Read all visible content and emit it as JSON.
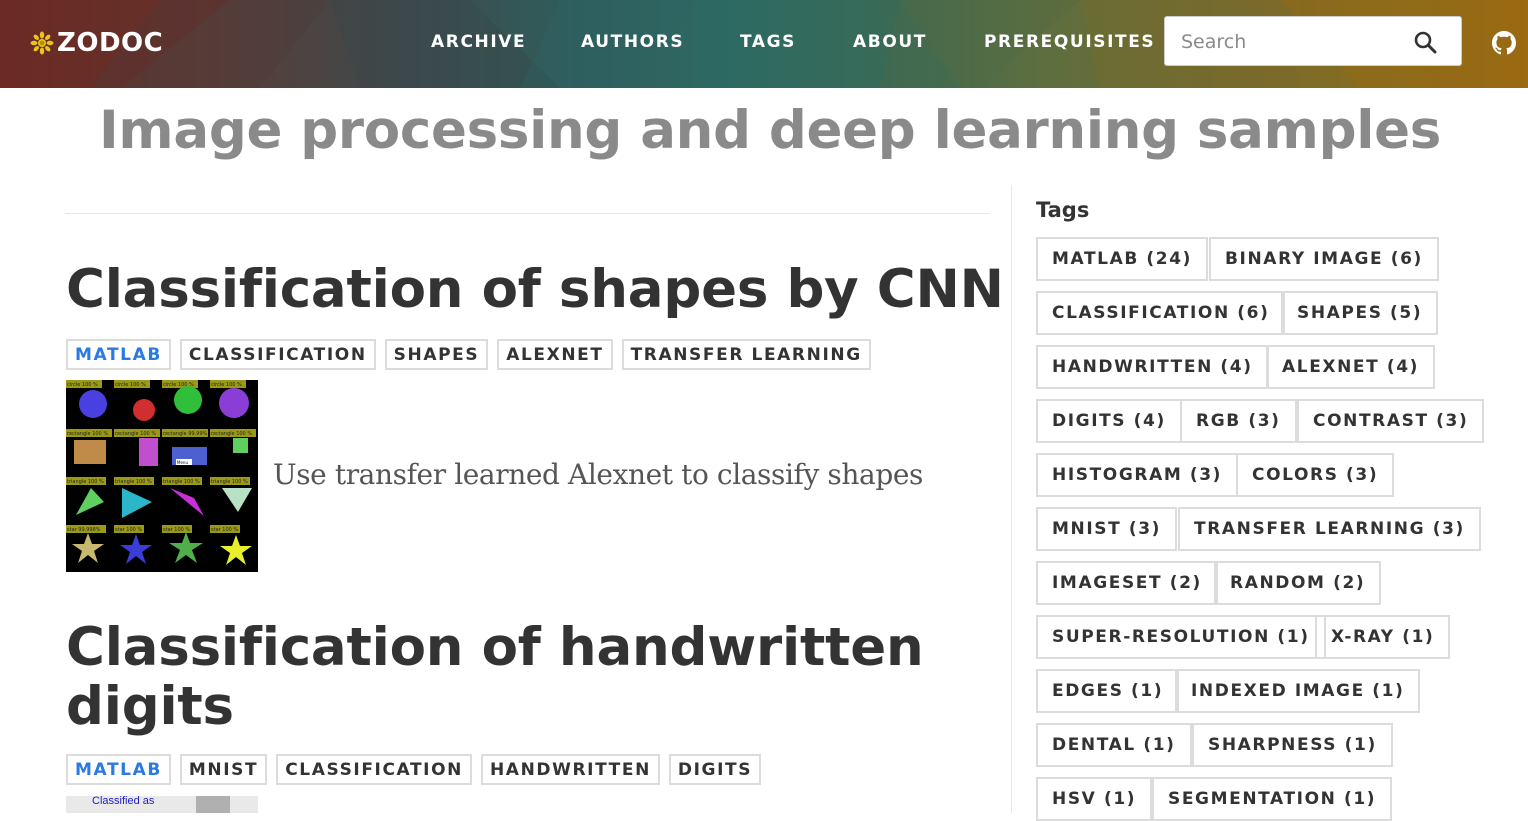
{
  "header": {
    "logo_text": "ZODOC",
    "nav": [
      "ARCHIVE",
      "AUTHORS",
      "TAGS",
      "ABOUT",
      "PREREQUISITES"
    ],
    "search_placeholder": "Search"
  },
  "page": {
    "title": "Image processing and deep learning samples"
  },
  "posts": [
    {
      "title": "Classification of shapes by CNN",
      "tags": [
        "MATLAB",
        "CLASSIFICATION",
        "SHAPES",
        "ALEXNET",
        "TRANSFER LEARNING"
      ],
      "excerpt": "Use transfer learned Alexnet to classify shapes",
      "thumb_labels": [
        "circle 100 %",
        "rectangle 100 %",
        "rectangle 99.99%",
        "triangle 100 %",
        "star 99.998%",
        "star 100 %"
      ],
      "thumb_overlay": "Menu"
    },
    {
      "title_line1": "Classification of handwritten",
      "title_line2": "digits",
      "tags": [
        "MATLAB",
        "MNIST",
        "CLASSIFICATION",
        "HANDWRITTEN",
        "DIGITS"
      ],
      "thumb_caption": "Classified as"
    }
  ],
  "sidebar": {
    "title": "Tags",
    "tags": [
      "MATLAB (24)",
      "BINARY IMAGE (6)",
      "CLASSIFICATION (6)",
      "SHAPES (5)",
      "HANDWRITTEN (4)",
      "ALEXNET (4)",
      "DIGITS (4)",
      "RGB (3)",
      "CONTRAST (3)",
      "HISTOGRAM (3)",
      "COLORS (3)",
      "MNIST (3)",
      "TRANSFER LEARNING (3)",
      "IMAGESET (2)",
      "RANDOM (2)",
      "SUPER-RESOLUTION (1)",
      "X-RAY (1)",
      "EDGES (1)",
      "INDEXED IMAGE (1)",
      "DENTAL (1)",
      "SHARPNESS (1)",
      "HSV (1)",
      "SEGMENTATION (1)"
    ]
  },
  "colors": {
    "tag_active": "#2a7ae2",
    "title_gray": "#8a8a8a",
    "text_dark": "#333333"
  }
}
